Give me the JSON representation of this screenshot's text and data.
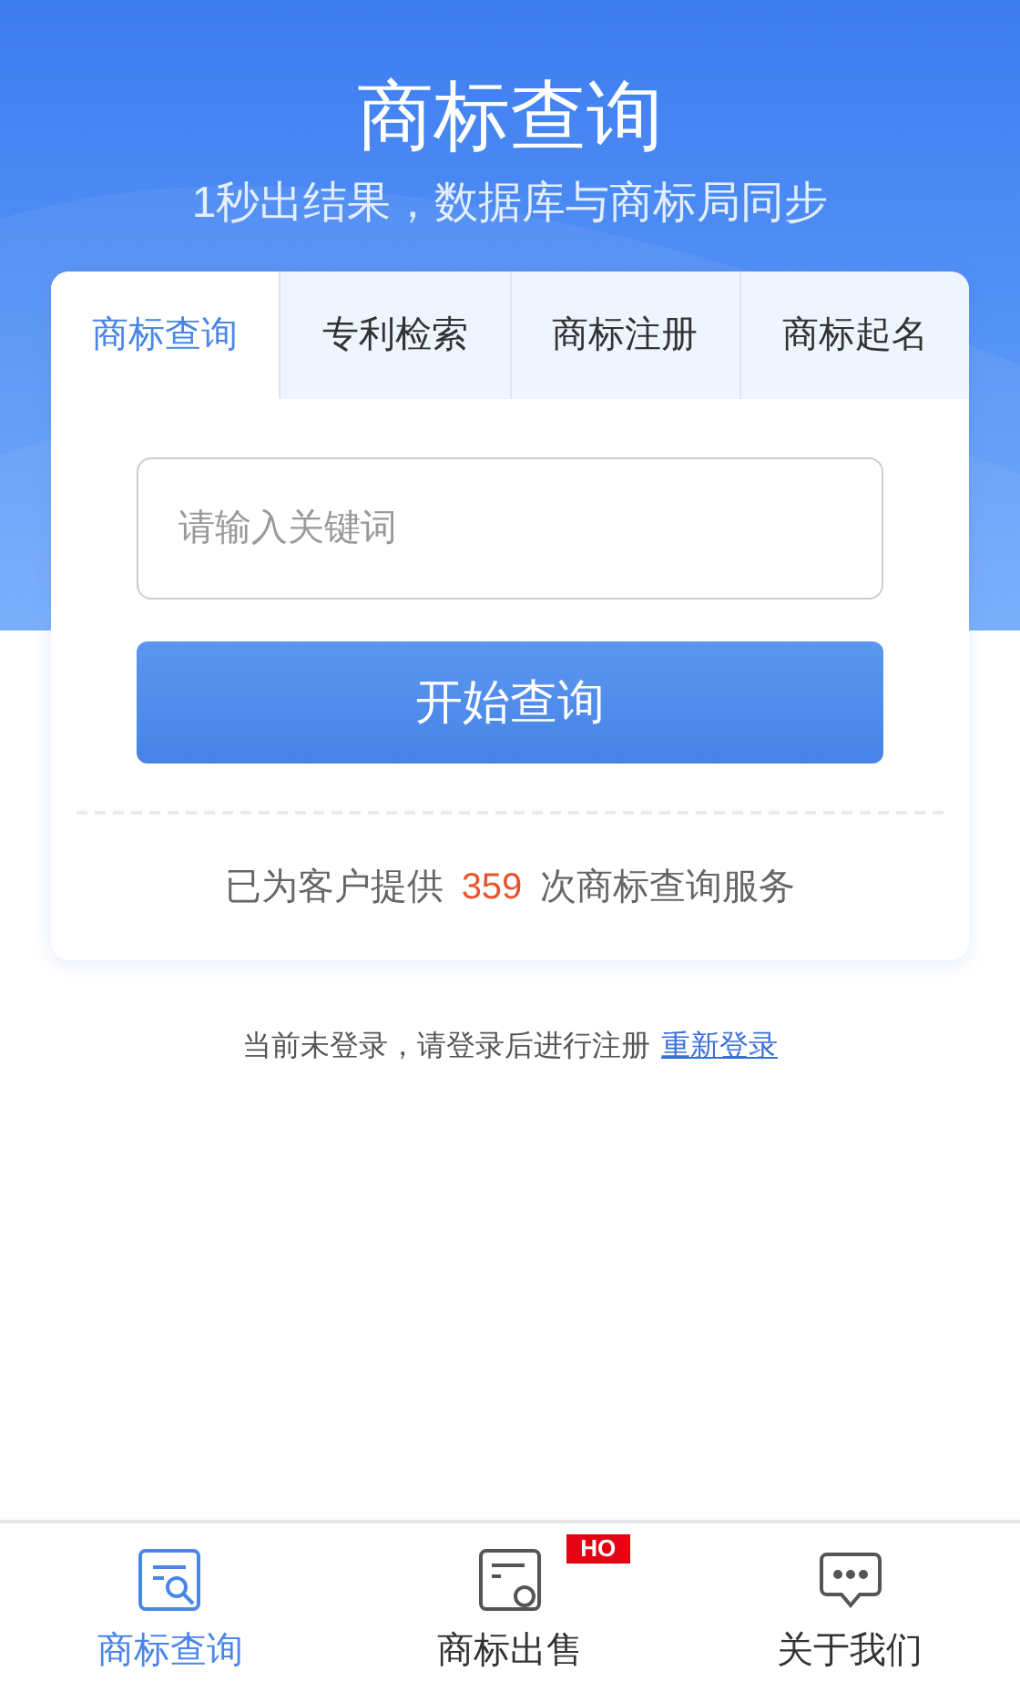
{
  "header": {
    "title": "商标查询",
    "subtitle": "1秒出结果，数据库与商标局同步"
  },
  "tabs": [
    {
      "label": "商标查询",
      "selected": true
    },
    {
      "label": "专利检索",
      "selected": false
    },
    {
      "label": "商标注册",
      "selected": false
    },
    {
      "label": "商标起名",
      "selected": false
    }
  ],
  "search": {
    "placeholder": "请输入关键词",
    "button": "开始查询"
  },
  "stats": {
    "prefix": "已为客户提供",
    "count": "359",
    "suffix": "次商标查询服务"
  },
  "login_notice": {
    "text": "当前未登录，请登录后进行注册",
    "link": "重新登录"
  },
  "bottom_nav": [
    {
      "label": "商标查询",
      "kind": "search",
      "selected": true
    },
    {
      "label": "商标出售",
      "kind": "sale",
      "selected": false,
      "badge": "HO"
    },
    {
      "label": "关于我们",
      "kind": "chat",
      "selected": false
    }
  ]
}
